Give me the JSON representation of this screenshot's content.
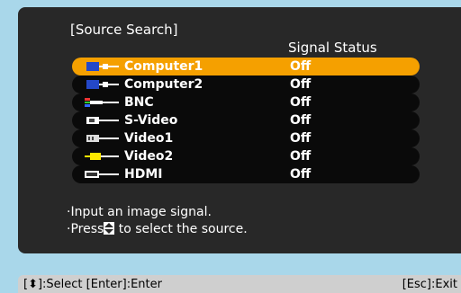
{
  "title": "[Source Search]",
  "column_header": "Signal Status",
  "sources": [
    {
      "label": "Computer1",
      "status": "Off",
      "icon": "computer-icon",
      "selected": true
    },
    {
      "label": "Computer2",
      "status": "Off",
      "icon": "computer-icon",
      "selected": false
    },
    {
      "label": "BNC",
      "status": "Off",
      "icon": "bnc-icon",
      "selected": false
    },
    {
      "label": "S-Video",
      "status": "Off",
      "icon": "s-video-icon",
      "selected": false
    },
    {
      "label": "Video1",
      "status": "Off",
      "icon": "video-icon",
      "selected": false
    },
    {
      "label": "Video2",
      "status": "Off",
      "icon": "rca-video-icon",
      "selected": false
    },
    {
      "label": "HDMI",
      "status": "Off",
      "icon": "hdmi-icon",
      "selected": false
    }
  ],
  "message": {
    "line1": "·Input an image signal.",
    "line2_prefix": "·Press",
    "line2_suffix": "to select the source."
  },
  "statusbar": {
    "left": "[⬍]:Select  [Enter]:Enter",
    "right": "[Esc]:Exit"
  },
  "colors": {
    "selected": "#f5a000",
    "panel": "#282828",
    "background": "#a9d7ea"
  }
}
